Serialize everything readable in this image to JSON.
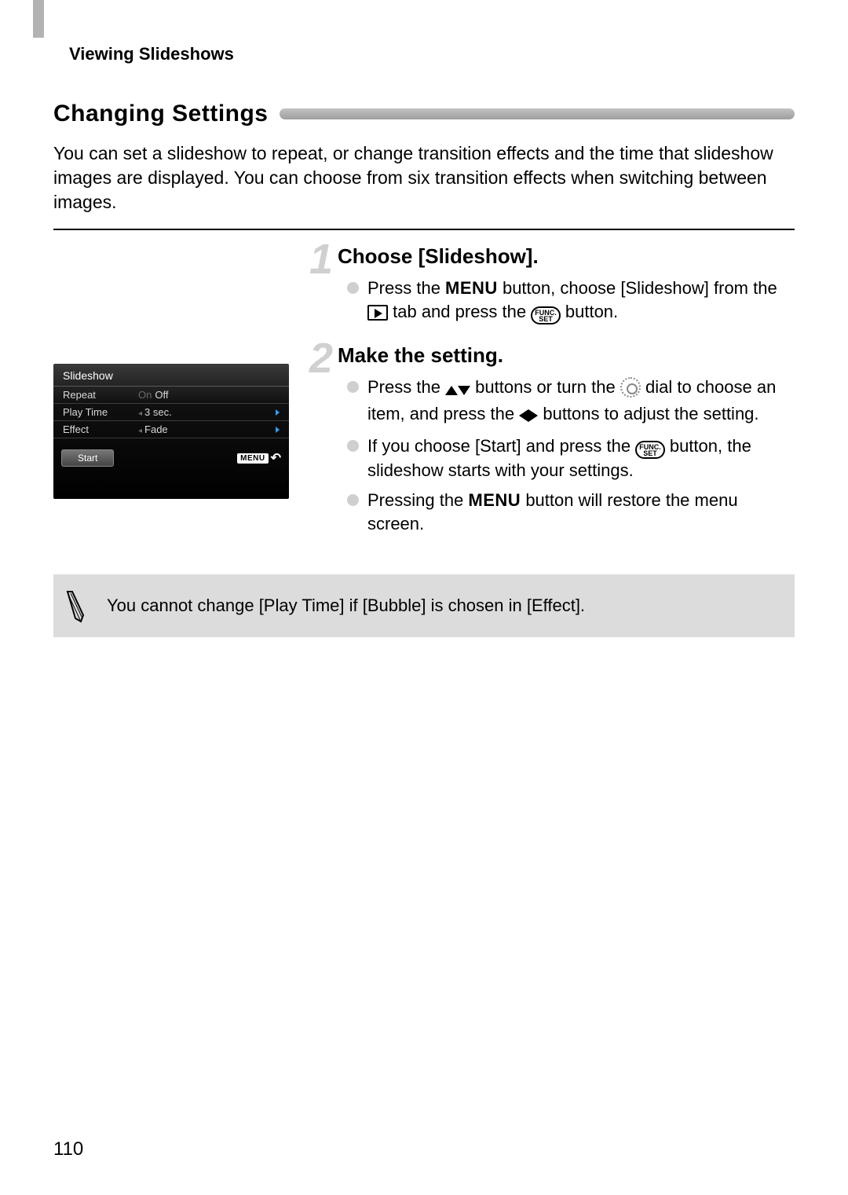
{
  "breadcrumb": "Viewing Slideshows",
  "section_title": "Changing Settings",
  "intro": "You can set a slideshow to repeat, or change transition effects and the time that slideshow images are displayed. You can choose from six transition effects when switching between images.",
  "lcd": {
    "title": "Slideshow",
    "rows": [
      {
        "label": "Repeat",
        "value_pre": "On",
        "value": "Off"
      },
      {
        "label": "Play Time",
        "value_pre": "◂",
        "value": "3 sec."
      },
      {
        "label": "Effect",
        "value_pre": "◂",
        "value": "Fade"
      }
    ],
    "start": "Start",
    "menu_badge": "MENU"
  },
  "steps": [
    {
      "num": "1",
      "title": "Choose [Slideshow].",
      "bullets": [
        {
          "pre": "Press the ",
          "icon1": "MENU",
          "mid": " button, choose [Slideshow] from the ",
          "icon2": "play",
          "mid2": " tab and press the ",
          "icon3": "func",
          "post": " button."
        }
      ]
    },
    {
      "num": "2",
      "title": "Make the setting.",
      "bullets": [
        {
          "pre": "Press the ",
          "icon1": "updown",
          "mid": " buttons or turn the ",
          "icon2": "dial",
          "mid2": " dial to choose an item, and press the ",
          "icon3": "leftright",
          "post": " buttons to adjust the setting."
        },
        {
          "pre": "If you choose [Start] and press the ",
          "icon1": "func",
          "post": " button, the slideshow starts with your settings."
        },
        {
          "pre": "Pressing the ",
          "icon1": "MENU",
          "post": " button will restore the menu screen."
        }
      ]
    }
  ],
  "note": "You cannot change [Play Time] if [Bubble] is chosen in [Effect].",
  "page_number": "110"
}
